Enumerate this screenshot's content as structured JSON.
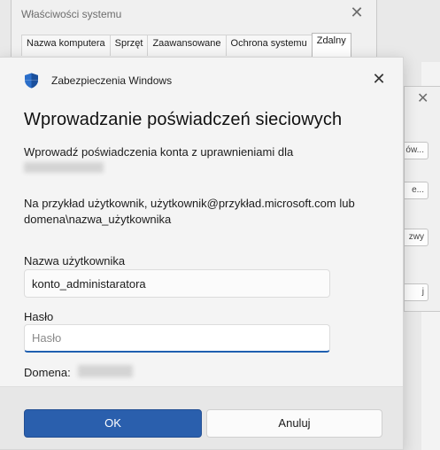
{
  "background_window": {
    "title": "Właściwości systemu",
    "close_glyph": "✕",
    "tabs": [
      {
        "label": "Nazwa komputera"
      },
      {
        "label": "Sprzęt"
      },
      {
        "label": "Zaawansowane"
      },
      {
        "label": "Ochrona systemu"
      },
      {
        "label": "Zdalny",
        "active": true
      }
    ]
  },
  "background_window2": {
    "close_glyph": "✕",
    "buttons": [
      "ów...",
      "e...",
      "zwy",
      "j"
    ]
  },
  "dialog": {
    "app_name": "Zabezpieczenia Windows",
    "close_glyph": "✕",
    "title": "Wprowadzanie poświadczeń sieciowych",
    "prompt": "Wprowadź poświadczenia konta z uprawnieniami dla",
    "example_line1": "Na przykład użytkownik, użytkownik@przykład.microsoft.com lub",
    "example_line2": "domena\\nazwa_użytkownika",
    "username_label": "Nazwa użytkownika",
    "username_value": "konto_administaratora",
    "password_label": "Hasło",
    "password_placeholder": "Hasło",
    "domain_label": "Domena:",
    "ok_label": "OK",
    "cancel_label": "Anuluj",
    "icons": {
      "app": "windows-security-shield-icon",
      "close": "close-icon"
    },
    "colors": {
      "accent": "#2a5fad",
      "shield": "#2b6ec9"
    }
  }
}
